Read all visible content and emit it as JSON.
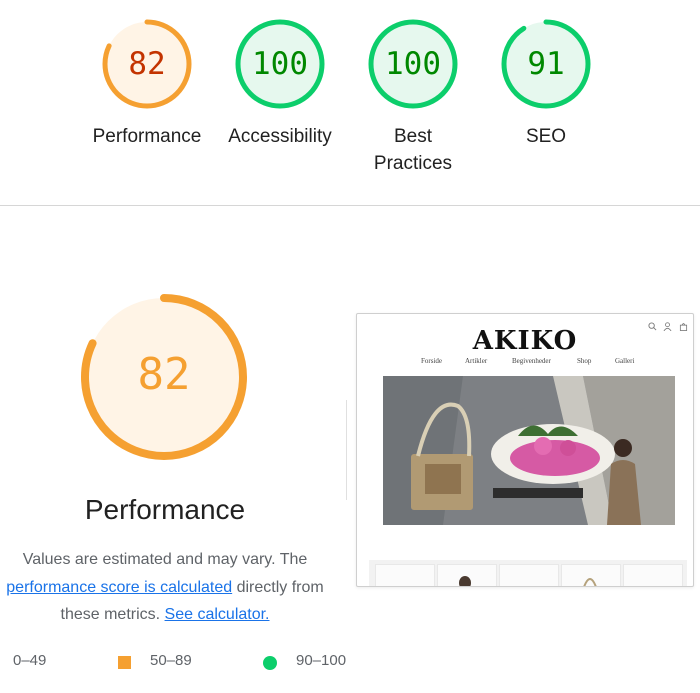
{
  "scores": [
    {
      "value": "82",
      "label": "Performance",
      "level": 0.82,
      "color": "#f5a031",
      "bg": "#fff4e6",
      "text_color": "#c33300"
    },
    {
      "value": "100",
      "label": "Accessibility",
      "level": 1.0,
      "color": "#0cce6b",
      "bg": "#e6f8ee",
      "text_color": "#008800"
    },
    {
      "value": "100",
      "label": "Best Practices",
      "level": 1.0,
      "color": "#0cce6b",
      "bg": "#e6f8ee",
      "text_color": "#008800"
    },
    {
      "value": "91",
      "label": "SEO",
      "level": 0.91,
      "color": "#0cce6b",
      "bg": "#e6f8ee",
      "text_color": "#008800"
    }
  ],
  "detail": {
    "score": "82",
    "level": 0.82,
    "title": "Performance",
    "desc_prefix": "Values are estimated and may vary. The",
    "link_score": "performance score is calculated",
    "desc_mid": " directly from these metrics.",
    "link_calc": "See calculator."
  },
  "legend": {
    "fail": "0–49",
    "average": "50–89",
    "pass": "90–100"
  },
  "screenshot": {
    "brand": "AKIKO",
    "nav": [
      "Forside",
      "Artikler",
      "Begivenheder",
      "Shop",
      "Galleri"
    ]
  }
}
